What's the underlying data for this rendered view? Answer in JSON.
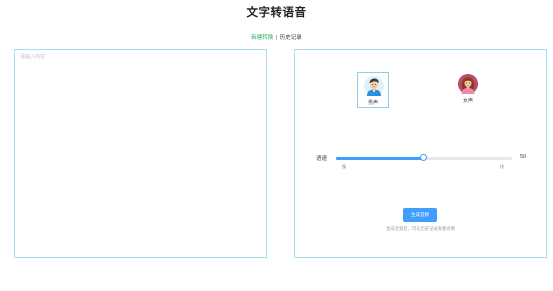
{
  "header": {
    "title": "文字转语音"
  },
  "nav": {
    "items": [
      {
        "label": "新建转换",
        "active": true
      },
      {
        "label": "历史记录",
        "active": false
      }
    ],
    "separator": "|"
  },
  "editor": {
    "placeholder": "请输入内容",
    "value": ""
  },
  "voices": [
    {
      "label": "男声",
      "icon": "male-avatar-icon",
      "selected": true
    },
    {
      "label": "女声",
      "icon": "female-avatar-icon",
      "selected": false
    }
  ],
  "speed": {
    "label": "语速",
    "value": "50",
    "level_percent": 50,
    "min_label": "慢",
    "max_label": "快"
  },
  "actions": {
    "generate_label": "生成音频",
    "hint": "生成音频后，可在历史记录查看详情"
  },
  "colors": {
    "accent": "#409eff",
    "nav_active": "#27b35a",
    "panel_border": "#a9dcee"
  }
}
